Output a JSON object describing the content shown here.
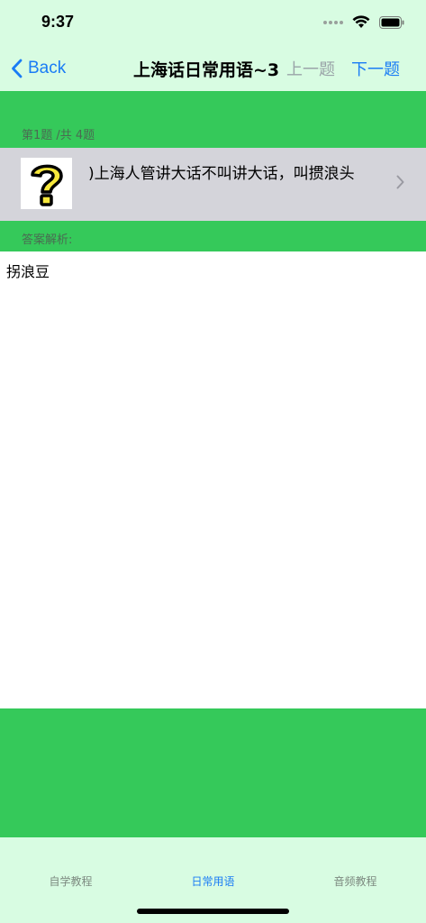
{
  "status": {
    "time": "9:37"
  },
  "nav": {
    "back_label": "Back",
    "title": "上海话日常用语~3",
    "prev_label": "上一题",
    "next_label": "下一题"
  },
  "question": {
    "counter": "第1题 /共 4题",
    "text": ")上海人管讲大话不叫讲大话，叫掼浪头",
    "icon": "question-mark-icon"
  },
  "answer": {
    "header": "答案解析:",
    "text": "拐浪豆"
  },
  "tabs": [
    {
      "label": "自学教程",
      "active": false
    },
    {
      "label": "日常用语",
      "active": true
    },
    {
      "label": "音频教程",
      "active": false
    }
  ],
  "colors": {
    "accent": "#1a7cf5",
    "green": "#35c95a",
    "background": "#d8fce2"
  }
}
